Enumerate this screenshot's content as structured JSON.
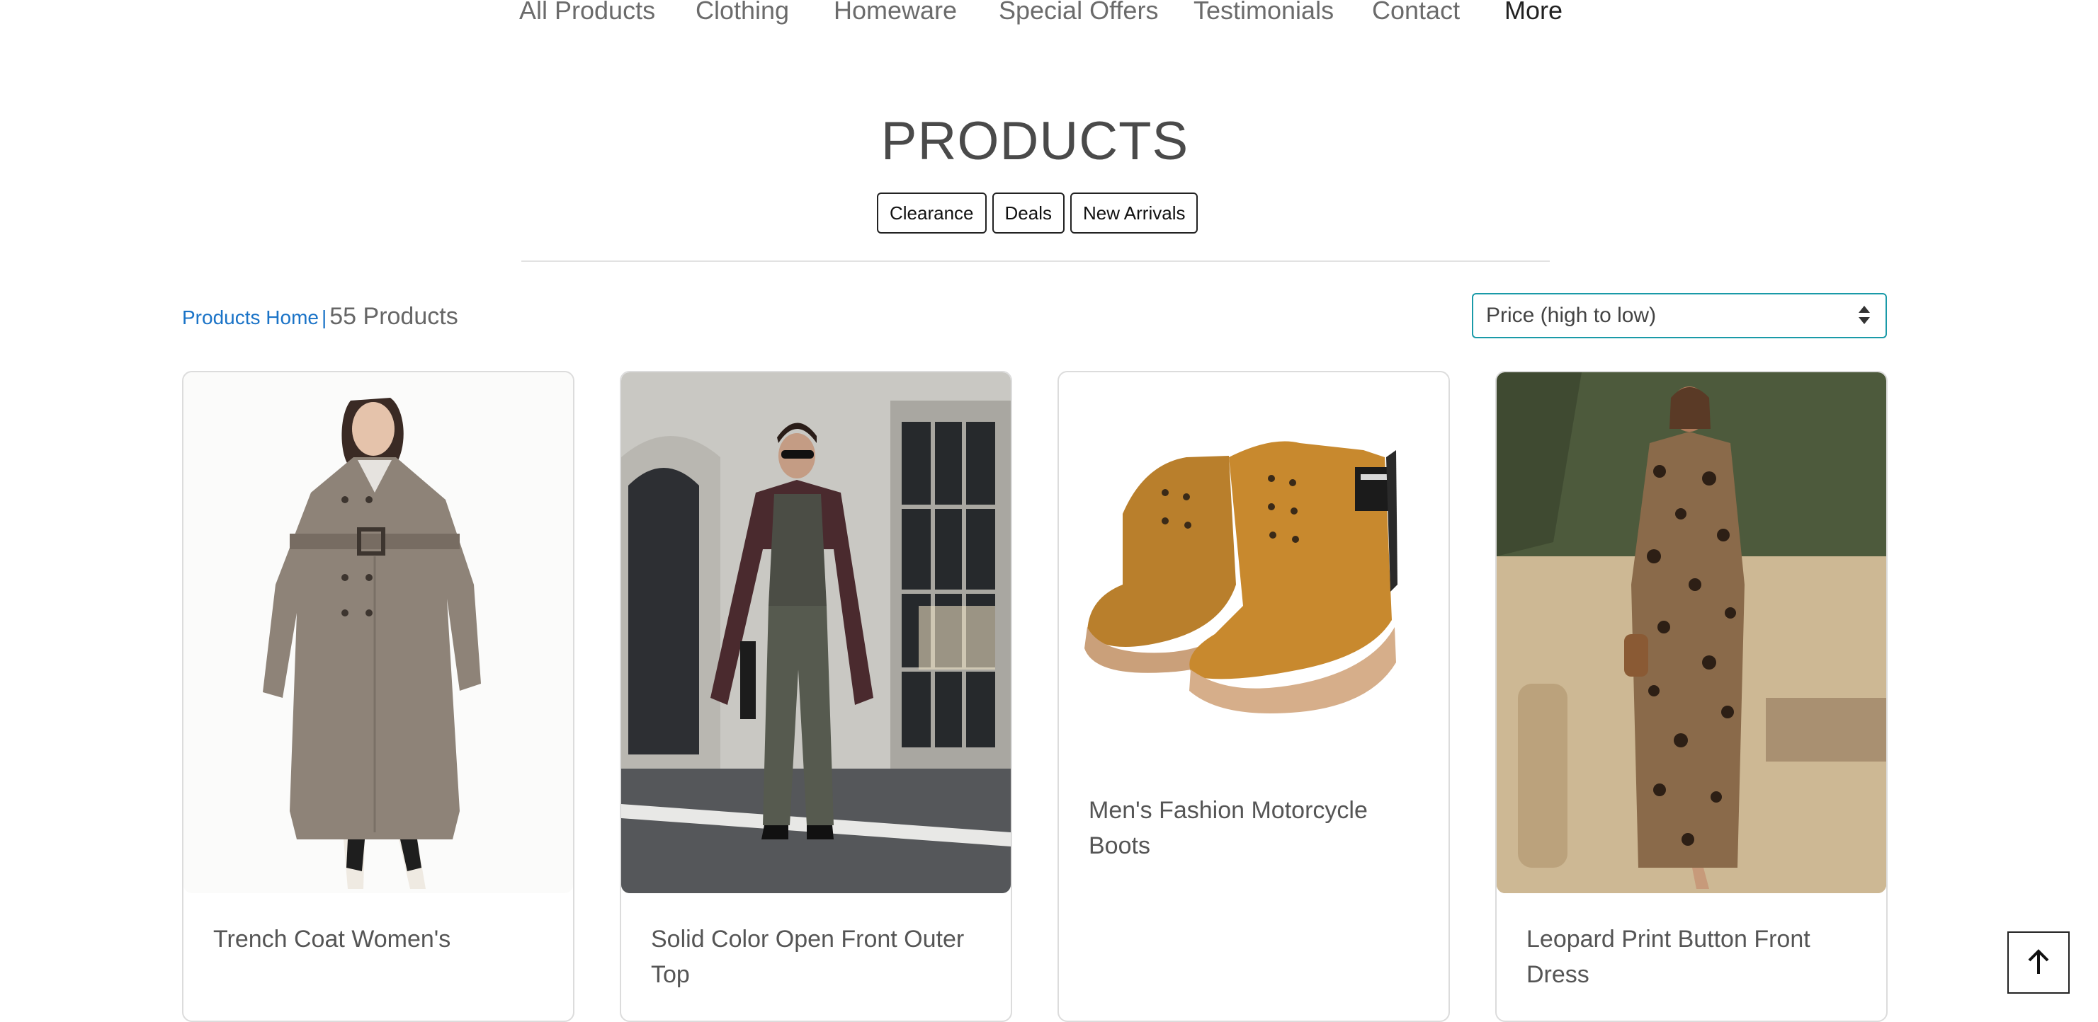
{
  "nav": {
    "items": [
      "All Products",
      "Clothing",
      "Homeware",
      "Special Offers",
      "Testimonials",
      "Contact",
      "More"
    ]
  },
  "page": {
    "title": "PRODUCTS"
  },
  "filters": [
    "Clearance",
    "Deals",
    "New Arrivals"
  ],
  "breadcrumb": {
    "home": "Products Home",
    "separator": "|",
    "count": "55 Products"
  },
  "sort": {
    "selected": "Price (high to low)"
  },
  "products": [
    {
      "name": "Trench Coat Women's"
    },
    {
      "name": "Solid Color Open Front Outer Top"
    },
    {
      "name": "Men's Fashion Motorcycle Boots"
    },
    {
      "name": "Leopard Print Button Front Dress"
    }
  ],
  "colors": {
    "link": "#1a73c7",
    "sort_border": "#1a9aa8",
    "text": "#555555"
  }
}
